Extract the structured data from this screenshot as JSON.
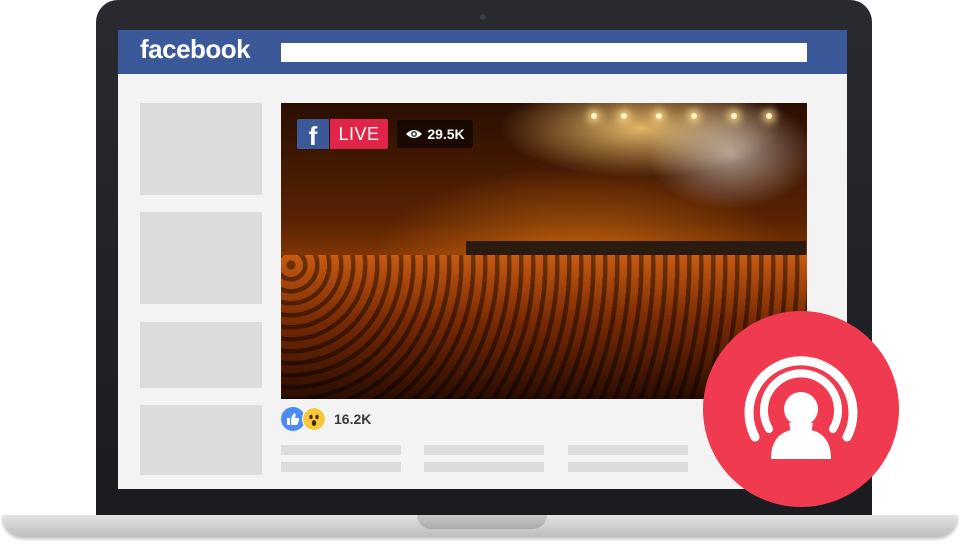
{
  "header": {
    "logo_text": "facebook",
    "search_value": ""
  },
  "video": {
    "platform_badge": "f",
    "live_label": "LIVE",
    "view_count": "29.5K"
  },
  "reactions": {
    "count": "16.2K",
    "icons": [
      "like-icon",
      "wow-icon"
    ]
  },
  "overlay": {
    "icon": "live-broadcast-icon"
  },
  "colors": {
    "facebook_blue": "#3b5998",
    "live_red": "#e0244a",
    "circle_red": "#f03a4f"
  }
}
